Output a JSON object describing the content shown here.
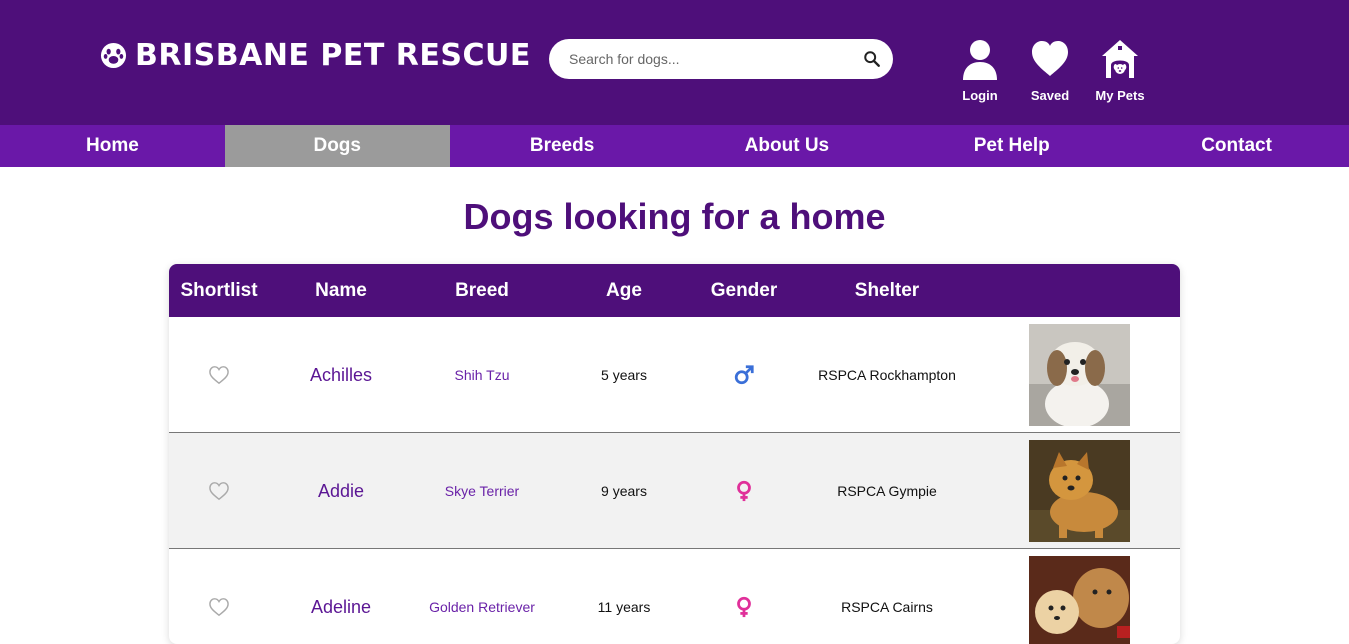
{
  "header": {
    "brand": "BRISBANE PET RESCUE",
    "search_placeholder": "Search for dogs...",
    "icons": [
      {
        "label": "Login",
        "icon": "user-icon"
      },
      {
        "label": "Saved",
        "icon": "heart-icon"
      },
      {
        "label": "My Pets",
        "icon": "dog-house-icon"
      }
    ]
  },
  "nav": {
    "items": [
      "Home",
      "Dogs",
      "Breeds",
      "About Us",
      "Pet Help",
      "Contact"
    ],
    "active": "Dogs"
  },
  "main": {
    "title": "Dogs looking for a home"
  },
  "table": {
    "headers": [
      "Shortlist",
      "Name",
      "Breed",
      "Age",
      "Gender",
      "Shelter"
    ],
    "rows": [
      {
        "name": "Achilles",
        "breed": "Shih Tzu",
        "age": "5 years",
        "gender": "male",
        "shelter": "RSPCA Rockhampton"
      },
      {
        "name": "Addie",
        "breed": "Skye Terrier",
        "age": "9 years",
        "gender": "female",
        "shelter": "RSPCA Gympie"
      },
      {
        "name": "Adeline",
        "breed": "Golden Retriever",
        "age": "11 years",
        "gender": "female",
        "shelter": "RSPCA Cairns"
      }
    ]
  },
  "colors": {
    "header_bg": "#4e0f7a",
    "nav_bg": "#6a18a8",
    "nav_active": "#9b9b9b",
    "male": "#3a6fd8",
    "female": "#e0309a"
  }
}
